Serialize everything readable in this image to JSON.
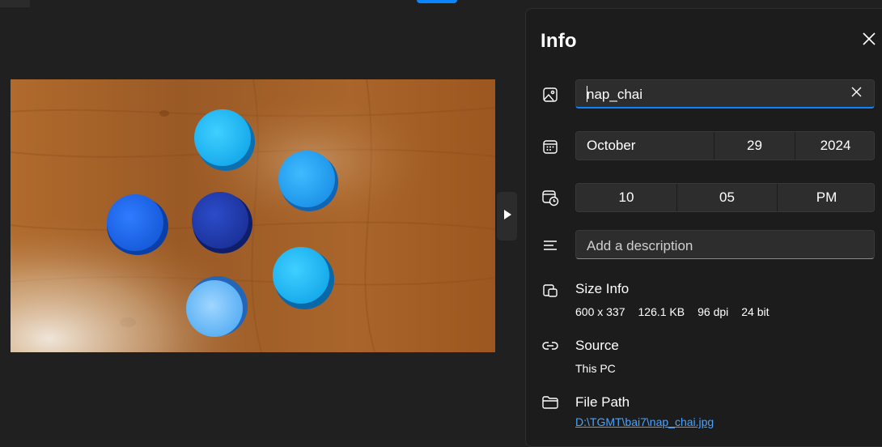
{
  "panel": {
    "title": "Info"
  },
  "file_name": {
    "value": "nap_chai"
  },
  "date": {
    "month": "October",
    "day": "29",
    "year": "2024"
  },
  "time": {
    "hour": "10",
    "minute": "05",
    "period": "PM"
  },
  "description": {
    "placeholder": "Add a description"
  },
  "size_info": {
    "label": "Size Info",
    "dimensions": "600 x 337",
    "file_size": "126.1 KB",
    "dpi": "96 dpi",
    "bit_depth": "24 bit"
  },
  "source": {
    "label": "Source",
    "value": "This PC"
  },
  "file_path": {
    "label": "File Path",
    "value": "D:\\TGMT\\bai7\\nap_chai.jpg"
  },
  "colors": {
    "accent": "#0a84ff",
    "panel_bg": "#1c1c1c",
    "page_bg": "#202020",
    "link": "#4aa3ff"
  },
  "icons": [
    "image-icon",
    "calendar-icon",
    "clock-icon",
    "description-icon",
    "size-icon",
    "link-icon",
    "folder-icon",
    "close-icon",
    "play-icon"
  ]
}
